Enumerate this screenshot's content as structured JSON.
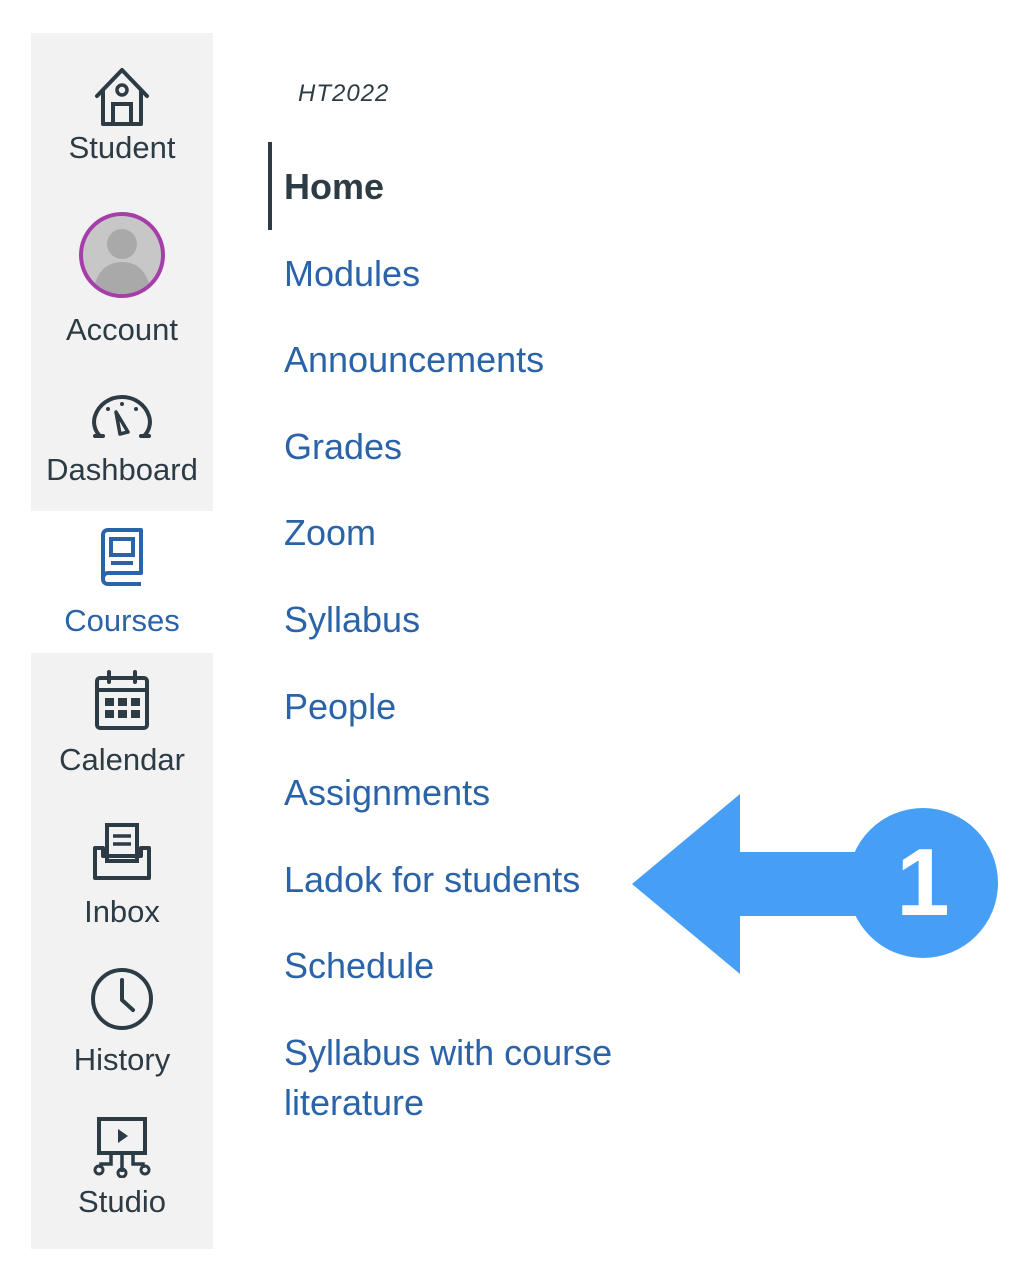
{
  "global_nav": {
    "items": [
      {
        "label": "Student",
        "icon": "house-icon"
      },
      {
        "label": "Account",
        "icon": "avatar"
      },
      {
        "label": "Dashboard",
        "icon": "speedometer-icon"
      },
      {
        "label": "Courses",
        "icon": "book-icon",
        "active": true
      },
      {
        "label": "Calendar",
        "icon": "calendar-icon"
      },
      {
        "label": "Inbox",
        "icon": "inbox-icon"
      },
      {
        "label": "History",
        "icon": "clock-icon"
      },
      {
        "label": "Studio",
        "icon": "studio-icon"
      }
    ]
  },
  "course_nav": {
    "term": "HT2022",
    "items": [
      {
        "label": "Home",
        "active": true
      },
      {
        "label": "Modules"
      },
      {
        "label": "Announcements"
      },
      {
        "label": "Grades"
      },
      {
        "label": "Zoom"
      },
      {
        "label": "Syllabus"
      },
      {
        "label": "People"
      },
      {
        "label": "Assignments"
      },
      {
        "label": "Ladok for students"
      },
      {
        "label": "Schedule"
      },
      {
        "label": "Syllabus with course literature"
      }
    ]
  },
  "callout": {
    "number": "1"
  },
  "colors": {
    "link": "#2b63a8",
    "text": "#2d3b45",
    "nav_bg": "#f2f2f2",
    "avatar_ring": "#a53ea8",
    "callout": "#469ff5"
  }
}
